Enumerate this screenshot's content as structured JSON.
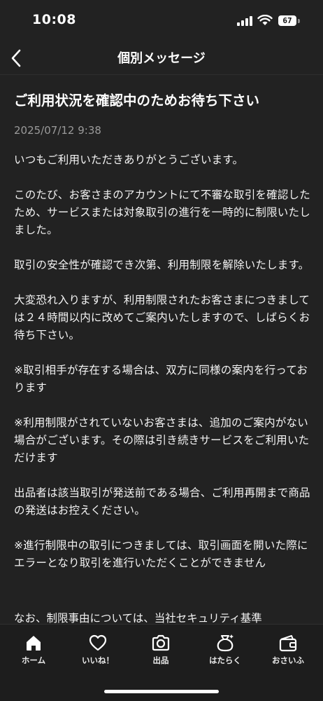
{
  "status_bar": {
    "time": "10:08",
    "battery": "67"
  },
  "header": {
    "title": "個別メッセージ"
  },
  "message": {
    "title": "ご利用状況を確認中のためお待ち下さい",
    "date": "2025/07/12 9:38",
    "paragraphs": [
      "いつもご利用いただきありがとうございます。",
      "このたび、お客さまのアカウントにて不審な取引を確認したため、サービスまたは対象取引の進行を一時的に制限いたしました。",
      "取引の安全性が確認でき次第、利用制限を解除いたします。",
      "大変恐れ入りますが、利用制限されたお客さまにつきましては２４時間以内に改めてご案内いたしますので、しばらくお待ち下さい。",
      "※取引相手が存在する場合は、双方に同様の案内を行っております",
      "※利用制限がされていないお客さまは、追加のご案内がない場合がございます。その際は引き続きサービスをご利用いただけます",
      "出品者は該当取引が発送前である場合、ご利用再開まで商品の発送はお控えください。",
      "※進行制限中の取引につきましては、取引画面を開いた際にエラーとなり取引を進行いただくことができません"
    ],
    "cutoff_line": "なお、制限事由については、当社セキュリティ基準"
  },
  "tabs": [
    {
      "label": "ホーム",
      "icon": "home-icon"
    },
    {
      "label": "いいね！",
      "icon": "heart-icon"
    },
    {
      "label": "出品",
      "icon": "camera-icon"
    },
    {
      "label": "はたらく",
      "icon": "bag-icon"
    },
    {
      "label": "おさいふ",
      "icon": "wallet-icon"
    }
  ],
  "colors": {
    "background": "#222222",
    "tab_bar": "#1d1d1d",
    "text": "#ffffff",
    "muted": "#9a9a9a"
  }
}
